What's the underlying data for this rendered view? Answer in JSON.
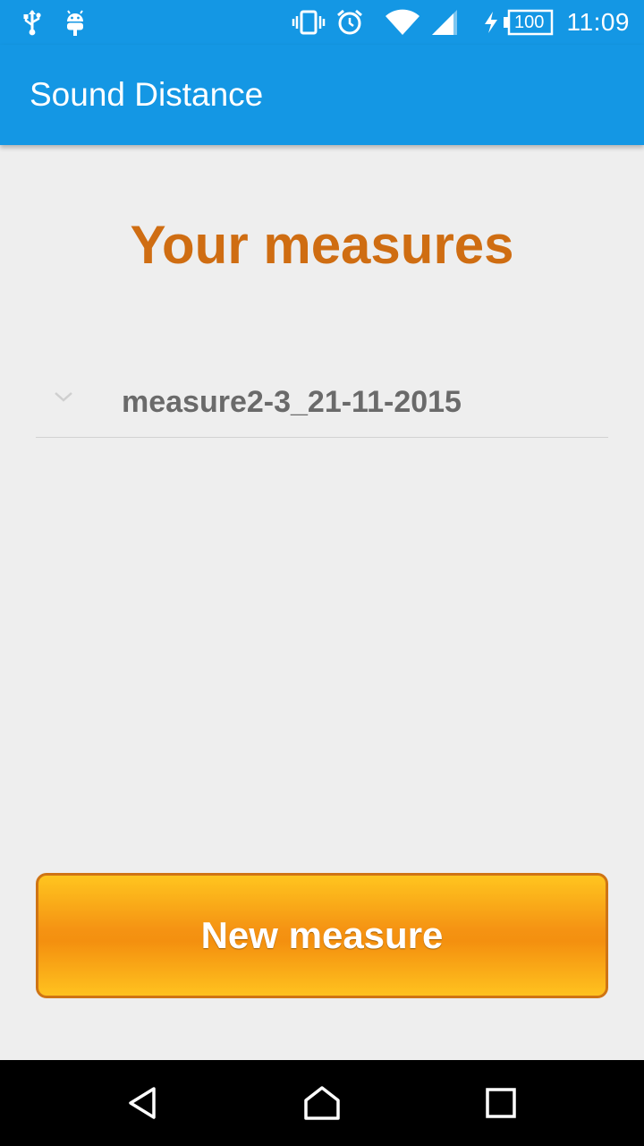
{
  "status_bar": {
    "time": "11:09",
    "battery": "100",
    "icons": [
      "usb-icon",
      "android-debug-icon",
      "vibrate-icon",
      "alarm-icon",
      "wifi-icon",
      "cell-signal-icon",
      "charging-icon",
      "battery-icon"
    ]
  },
  "app_bar": {
    "title": "Sound Distance"
  },
  "main": {
    "heading": "Your measures",
    "measures": [
      {
        "name": "measure2-3_21-11-2015"
      }
    ],
    "new_button_label": "New measure"
  },
  "nav_bar": {
    "icons": [
      "back-icon",
      "home-icon",
      "recents-icon"
    ]
  },
  "colors": {
    "primary": "#1497e4",
    "heading": "#cf6d12",
    "button_orange": "#f59313",
    "button_border": "#cf7414",
    "background": "#eeeeee"
  }
}
